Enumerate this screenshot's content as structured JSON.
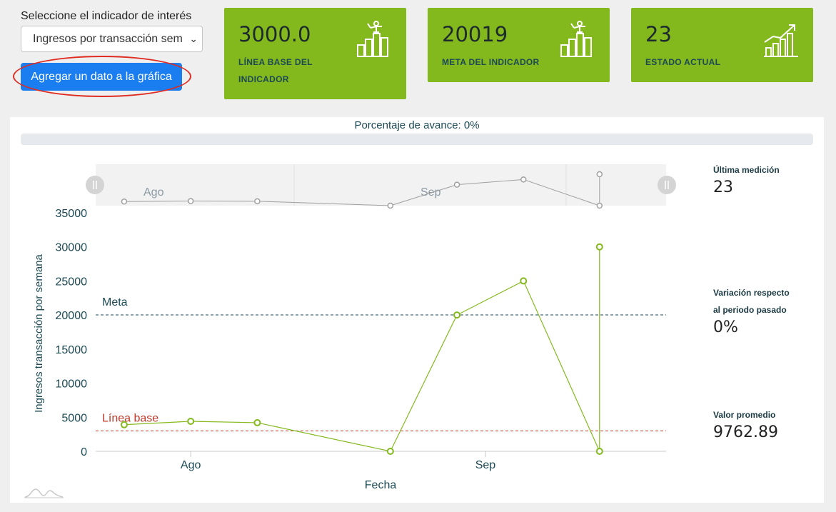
{
  "selector": {
    "label": "Seleccione el indicador de interés",
    "value": "Ingresos por transacción sem",
    "button": "Agregar un dato a la gráfica"
  },
  "cards": [
    {
      "value": "3000.0",
      "label": "LÍNEA BASE DEL INDICADOR",
      "icon": "podium-bars-icon"
    },
    {
      "value": "20019",
      "label": "META DEL INDICADOR",
      "icon": "podium-bars-icon"
    },
    {
      "value": "23",
      "label": "ESTADO ACTUAL",
      "icon": "growth-chart-icon"
    }
  ],
  "progress": {
    "label": "Porcentaje de avance: 0%",
    "percent": 0
  },
  "stats": {
    "last_label": "Última medición",
    "last_value": "23",
    "variation_label_1": "Variación respecto",
    "variation_label_2": "al periodo pasado",
    "variation_value": "0%",
    "avg_label": "Valor promedio",
    "avg_value": "9762.89"
  },
  "colors": {
    "card": "#84b91e",
    "button": "#1a7ef0",
    "series": "#84b91e",
    "meta": "#1b4a55",
    "baseline": "#c0392b"
  },
  "chart_data": {
    "type": "line",
    "xlabel": "Fecha",
    "ylabel": "Ingresos transacción por semana",
    "ylim": [
      0,
      35000
    ],
    "yticks": [
      0,
      5000,
      10000,
      15000,
      20000,
      25000,
      30000,
      35000
    ],
    "xticks": [
      "Ago",
      "Sep"
    ],
    "x": [
      "2019-07-25",
      "2019-08-01",
      "2019-08-08",
      "2019-08-22",
      "2019-08-29",
      "2019-09-05",
      "2019-09-13",
      "2019-09-13"
    ],
    "series": [
      {
        "values": [
          3900,
          4400,
          4200,
          0,
          20000,
          25000,
          0,
          30000
        ]
      }
    ],
    "reference_lines": [
      {
        "label": "Meta",
        "value": 20019
      },
      {
        "label": "Línea base",
        "value": 3000
      }
    ],
    "navigator": {
      "labels": [
        "Ago",
        "Sep"
      ]
    }
  }
}
